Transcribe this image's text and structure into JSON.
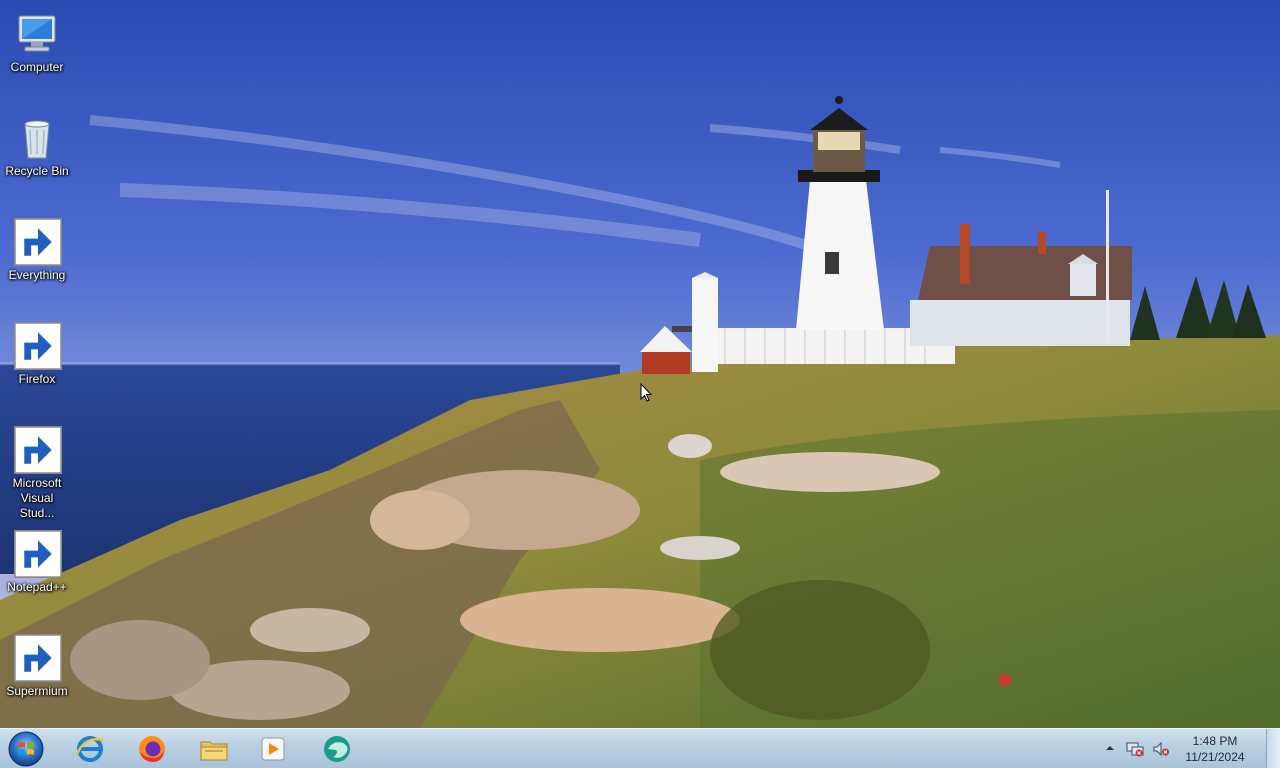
{
  "desktop": {
    "icons": [
      {
        "label": "Computer",
        "icon": "computer-icon"
      },
      {
        "label": "Recycle Bin",
        "icon": "recycle-bin-icon"
      },
      {
        "label": "Everything",
        "icon": "everything-icon"
      },
      {
        "label": "Firefox",
        "icon": "firefox-icon"
      },
      {
        "label": "Microsoft Visual Stud...",
        "icon": "visual-studio-icon"
      },
      {
        "label": "Notepad++",
        "icon": "notepadpp-icon"
      },
      {
        "label": "Supermium",
        "icon": "supermium-icon"
      }
    ]
  },
  "taskbar": {
    "start": {
      "icon": "windows-start-icon"
    },
    "pinned": [
      {
        "icon": "internet-explorer-icon"
      },
      {
        "icon": "firefox-icon"
      },
      {
        "icon": "file-explorer-icon"
      },
      {
        "icon": "media-player-icon"
      },
      {
        "icon": "supermium-icon"
      }
    ],
    "tray": {
      "time": "1:48 PM",
      "date": "11/21/2024",
      "icons": [
        "show-hidden-icons-arrow",
        "network-icon",
        "volume-muted-icon"
      ]
    }
  },
  "colors": {
    "taskbar": "#b8cfe2",
    "sky_top": "#2f4fb5",
    "sea": "#2b4a9a",
    "grass": "#8a8a3c"
  }
}
